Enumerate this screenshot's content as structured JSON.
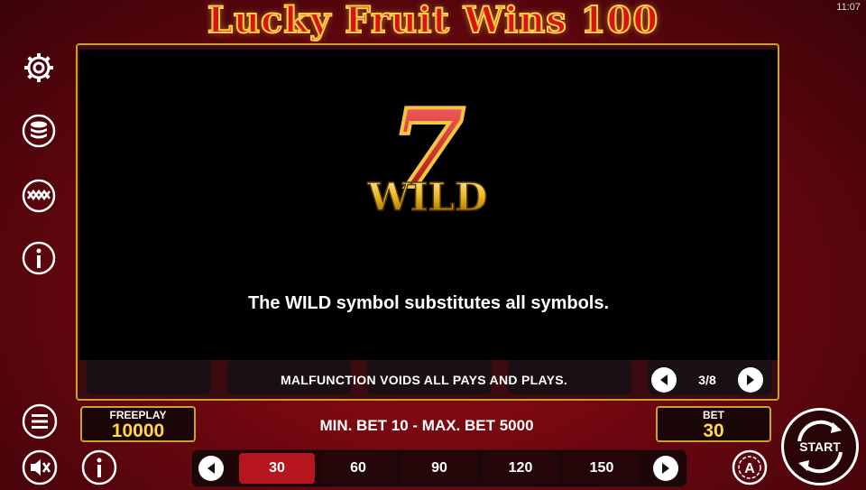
{
  "status_bar": {
    "time": "11:07"
  },
  "game": {
    "title": "Lucky Fruit Wins 100"
  },
  "sidebar": {
    "icons": [
      "gear-icon",
      "coins-icon",
      "paytable-icon",
      "info-icon"
    ]
  },
  "info_panel": {
    "symbol": {
      "number": "7",
      "word": "WILD"
    },
    "description": "The WILD symbol substitutes all symbols.",
    "disclaimer": "MALFUNCTION VOIDS ALL PAYS AND PLAYS.",
    "page_indicator": "3/8"
  },
  "freeplay": {
    "label": "FREEPLAY",
    "value": "10000"
  },
  "limits": {
    "text": "MIN. BET 10 - MAX. BET 5000"
  },
  "bet": {
    "label": "BET",
    "value": "30"
  },
  "bet_options": {
    "values": [
      "30",
      "60",
      "90",
      "120",
      "150"
    ],
    "selected": "30"
  },
  "start_button": {
    "label": "START"
  },
  "colors": {
    "accent_gold": "#c9a227",
    "selected_red": "#b5161d",
    "value_yellow": "#ffd84a"
  }
}
